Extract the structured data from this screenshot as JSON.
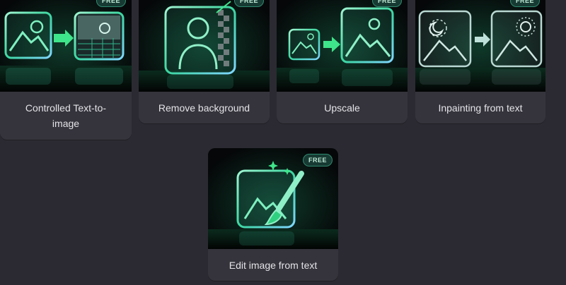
{
  "badge_text": "FREE",
  "colors": {
    "page_bg": "#2b2a32",
    "card_bg": "#35343c",
    "accent_green": "#39e58a",
    "badge_bg": "#173a33"
  },
  "cards": [
    {
      "label": "Controlled Text-to-image",
      "badge": "FREE",
      "icon": "image-to-grid-transform-icon"
    },
    {
      "label": "Remove background",
      "badge": "FREE",
      "icon": "person-remove-background-icon"
    },
    {
      "label": "Upscale",
      "badge": "FREE",
      "icon": "upscale-image-icon"
    },
    {
      "label": "Inpainting from text",
      "badge": "FREE",
      "icon": "night-to-day-image-icon"
    },
    {
      "label": "Edit image from text",
      "badge": "FREE",
      "icon": "image-paintbrush-icon"
    }
  ]
}
